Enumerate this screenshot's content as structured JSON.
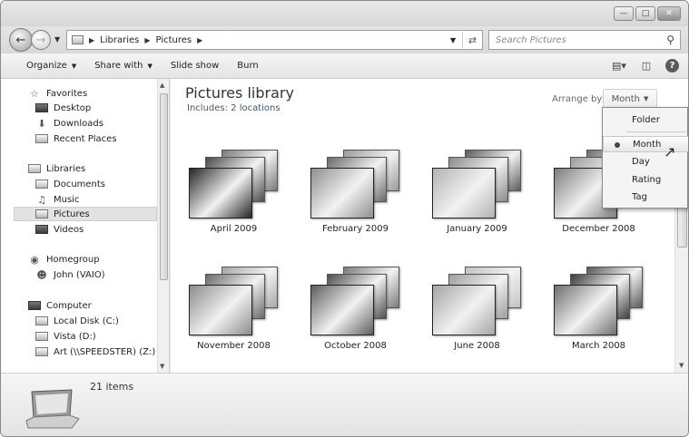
{
  "window": {
    "controls": {
      "minimize_icon": "minimize-icon",
      "maximize_icon": "maximize-icon",
      "close_icon": "close-icon"
    }
  },
  "address": {
    "crumbs": [
      "Libraries",
      "Pictures"
    ],
    "search_placeholder": "Search Pictures"
  },
  "toolbar": {
    "organize": "Organize",
    "share_with": "Share with",
    "slide_show": "Slide show",
    "burn": "Burn"
  },
  "nav": {
    "favorites": {
      "label": "Favorites",
      "items": [
        "Desktop",
        "Downloads",
        "Recent Places"
      ]
    },
    "libraries": {
      "label": "Libraries",
      "items": [
        "Documents",
        "Music",
        "Pictures",
        "Videos"
      ],
      "selected": "Pictures"
    },
    "homegroup": {
      "label": "Homegroup",
      "items": [
        "John (VAIO)"
      ]
    },
    "computer": {
      "label": "Computer",
      "items": [
        "Local Disk (C:)",
        "Vista (D:)",
        "Art (\\\\SPEEDSTER) (Z:)"
      ]
    }
  },
  "library": {
    "title": "Pictures library",
    "includes_label": "Includes:",
    "includes_link": "2 locations",
    "arrange_label": "Arrange by:",
    "arrange_value": "Month"
  },
  "groups": [
    {
      "label": "April 2009",
      "colors": [
        "#7a7a7a",
        "#4a4a4a",
        "#262626"
      ]
    },
    {
      "label": "February 2009",
      "colors": [
        "#9a9a9a",
        "#6b6b6b",
        "#8f8f8f"
      ]
    },
    {
      "label": "January 2009",
      "colors": [
        "#5c5c5c",
        "#8a8a8a",
        "#b3b3b3"
      ]
    },
    {
      "label": "December 2008",
      "colors": [
        "#6e6e6e",
        "#9c9c9c",
        "#7d7d7d"
      ]
    },
    {
      "label": "November 2008",
      "colors": [
        "#a8a8a8",
        "#6a6a6a",
        "#8c8c8c"
      ]
    },
    {
      "label": "October 2008",
      "colors": [
        "#7b7b7b",
        "#4f4f4f",
        "#5e5e5e"
      ]
    },
    {
      "label": "June 2008",
      "colors": [
        "#c2c2c2",
        "#9e9e9e",
        "#a5a5a5"
      ]
    },
    {
      "label": "March 2008",
      "colors": [
        "#595959",
        "#3c3c3c",
        "#6f6f6f"
      ]
    }
  ],
  "arrange_menu": {
    "options": [
      "Folder",
      "Month",
      "Day",
      "Rating",
      "Tag"
    ],
    "selected": "Month"
  },
  "details": {
    "count": "21 items"
  }
}
